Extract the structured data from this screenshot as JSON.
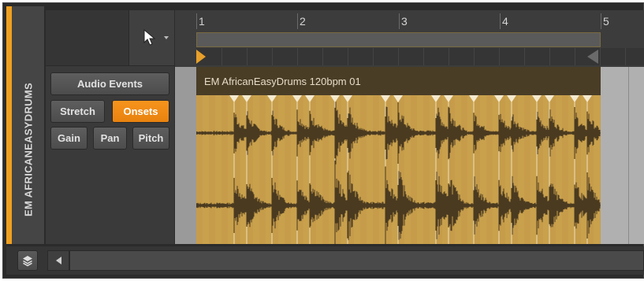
{
  "track": {
    "name": "EM AFRICANEASYDRUMS",
    "color": "#f0a020"
  },
  "toolbar": {
    "tool_icon": "pointer-arrow-icon"
  },
  "inspector": {
    "audio_events_label": "Audio Events",
    "stretch_label": "Stretch",
    "onsets_label": "Onsets",
    "gain_label": "Gain",
    "pan_label": "Pan",
    "pitch_label": "Pitch",
    "active_button": "Onsets",
    "accent_color": "#f7941d"
  },
  "ruler": {
    "bars": [
      "1",
      "2",
      "3",
      "4",
      "5"
    ]
  },
  "clip": {
    "title": "EM AfricanEasyDrums 120bpm 01",
    "color": "#c9a14d"
  },
  "bottom_bar": {
    "layers_icon": "layers-icon",
    "scroll_icon": "scroll-left-icon"
  }
}
